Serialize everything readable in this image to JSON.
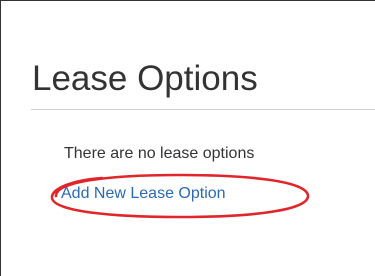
{
  "section": {
    "title": "Lease Options",
    "empty_message": "There are no lease options",
    "add_link_label": "Add New Lease Option"
  },
  "annotation": {
    "type": "hand-drawn ellipse",
    "color": "#e0262a"
  },
  "colors": {
    "link": "#2a6ab4",
    "text": "#333333",
    "divider": "#d0d0d0"
  }
}
